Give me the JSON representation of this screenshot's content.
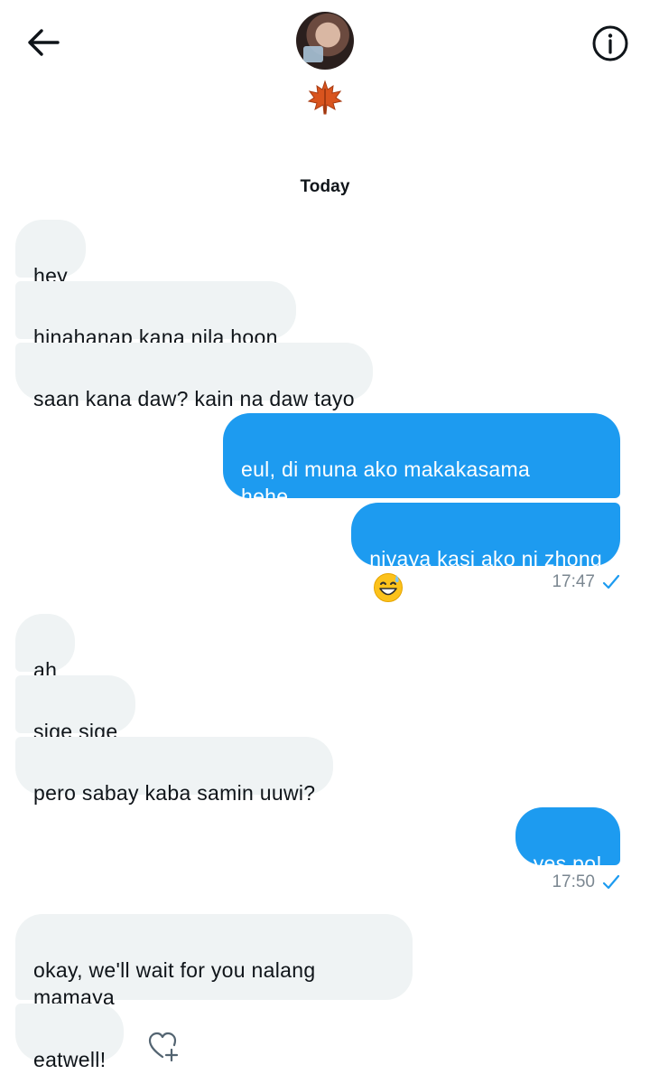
{
  "header": {
    "avatar_icon": "profile-photo",
    "name_icon": "maple-leaf-emoji",
    "back_icon": "back-arrow-icon",
    "info_icon": "info-icon"
  },
  "day_label": "Today",
  "messages": [
    {
      "from": "them",
      "text": "hey"
    },
    {
      "from": "them",
      "text": "hinahanap kana nila hoon"
    },
    {
      "from": "them",
      "text": "saan kana daw? kain na daw tayo"
    },
    {
      "from": "me",
      "text": "eul, di muna ako makakasama\nhehe"
    },
    {
      "from": "me",
      "text": "niyaya kasi ako ni zhong",
      "emoji": "grinning-sweat-emoji"
    },
    {
      "from": "them",
      "text": "ah"
    },
    {
      "from": "them",
      "text": "sige sige"
    },
    {
      "from": "them",
      "text": "pero sabay kaba samin uuwi?"
    },
    {
      "from": "me",
      "text": "yes po!"
    },
    {
      "from": "them",
      "text": "okay, we'll wait for you nalang\nmamaya"
    },
    {
      "from": "them",
      "text": "eatwell!"
    }
  ],
  "timestamps": [
    "17:47",
    "17:50"
  ],
  "colors": {
    "outgoing_bubble": "#1d9bf0",
    "incoming_bubble": "#eff3f4",
    "check_mark": "#1d9bf0"
  }
}
